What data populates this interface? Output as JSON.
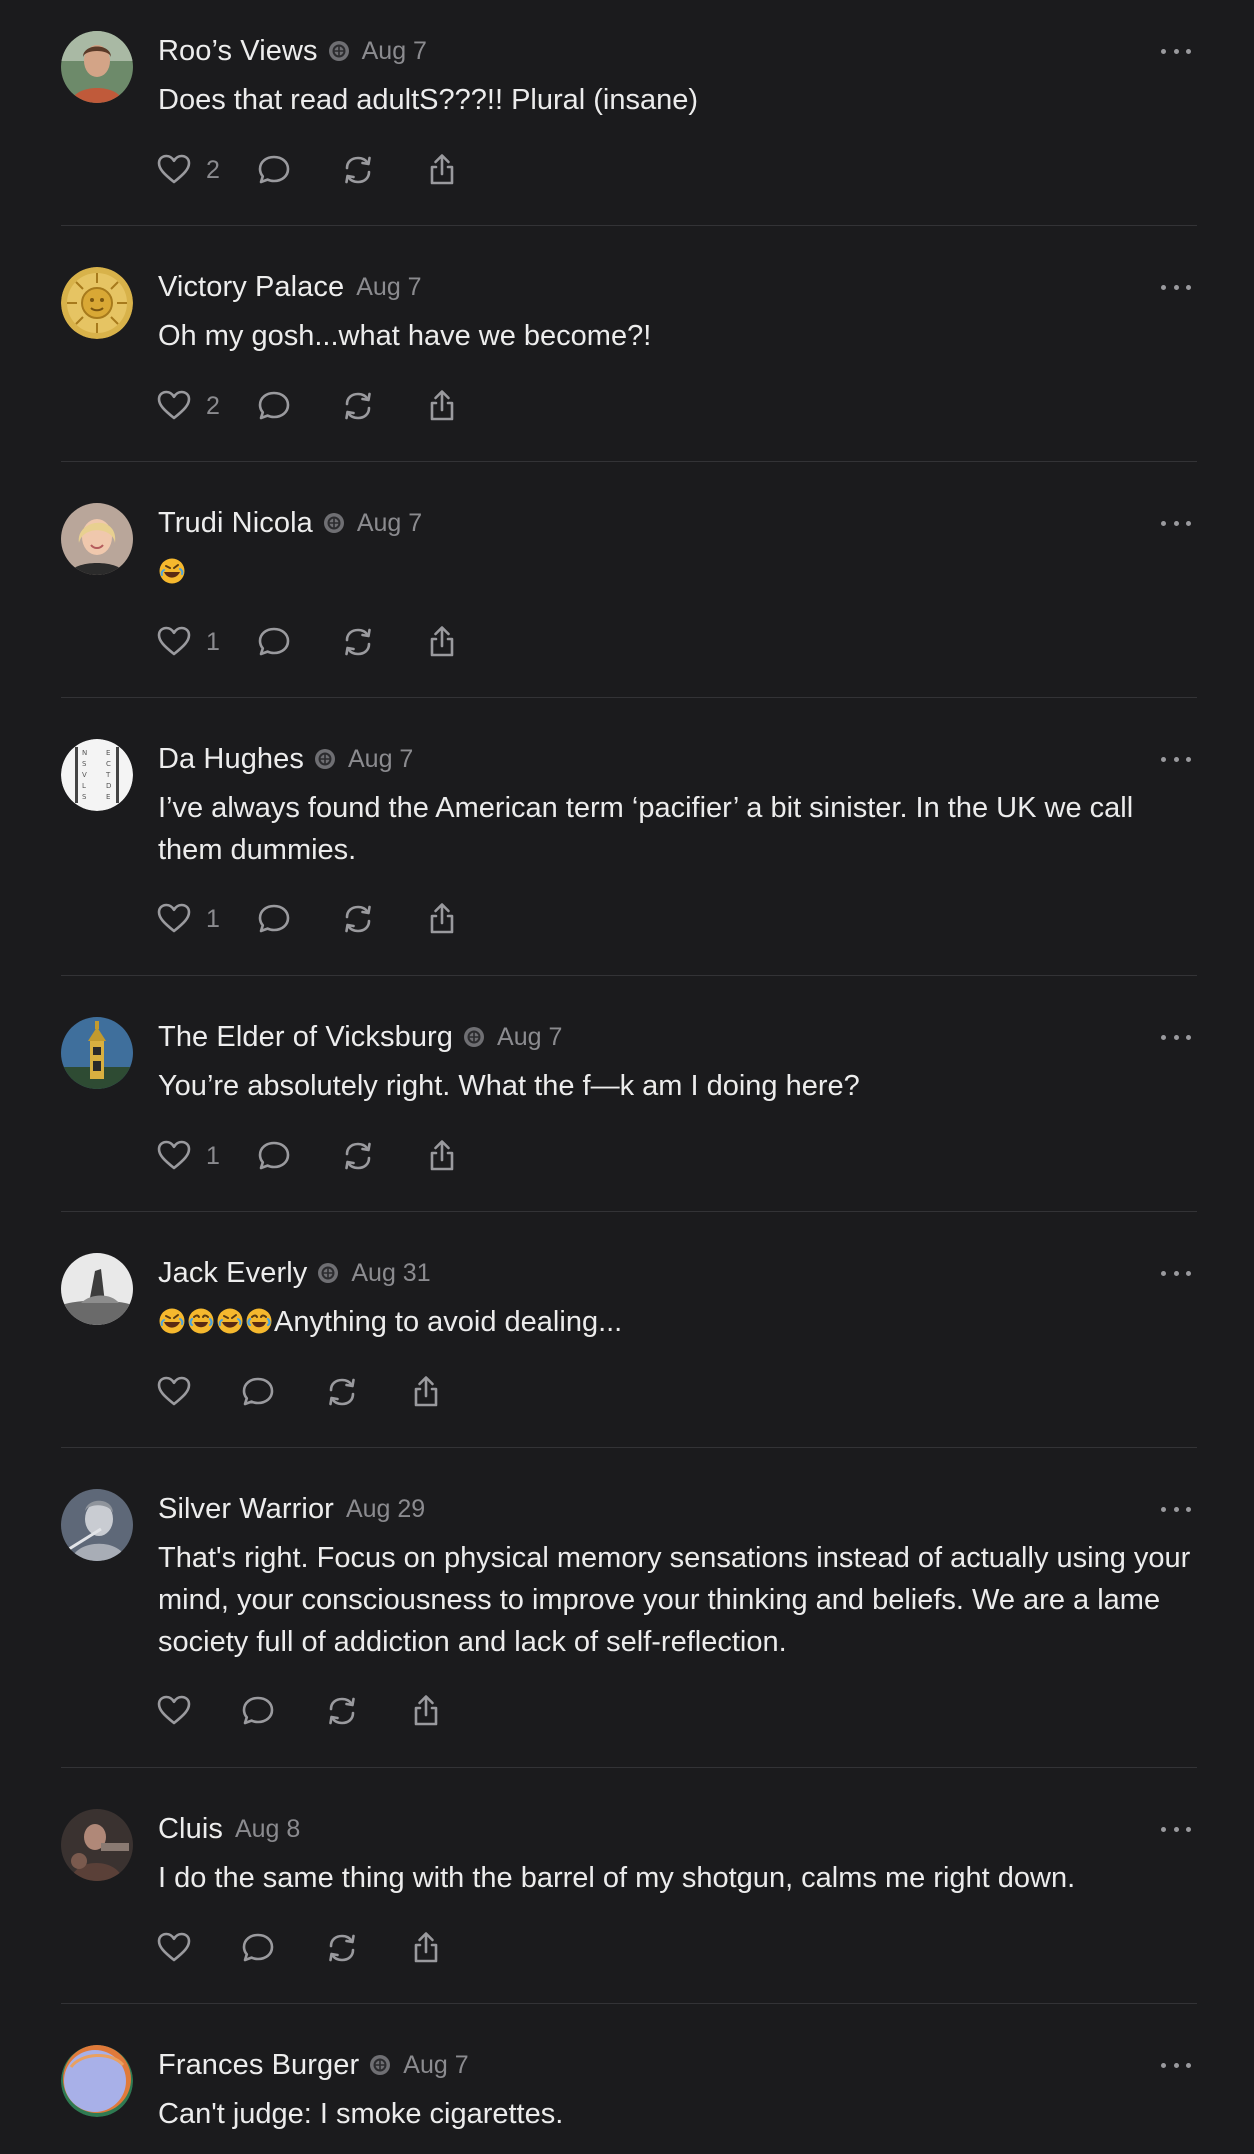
{
  "comments": [
    {
      "author": "Roo’s Views",
      "verified": true,
      "date": "Aug 7",
      "text": "Does that read adultS???!! Plural (insane)",
      "likes": "2",
      "avatar": "person-photo"
    },
    {
      "author": "Victory Palace",
      "verified": false,
      "date": "Aug 7",
      "text": "Oh my gosh...what have we become?!",
      "likes": "2",
      "avatar": "gold-sun-emblem"
    },
    {
      "author": "Trudi Nicola",
      "verified": true,
      "date": "Aug 7",
      "text": "",
      "emoji": [
        "rofl"
      ],
      "likes": "1",
      "avatar": "person-photo"
    },
    {
      "author": "Da Hughes",
      "verified": true,
      "date": "Aug 7",
      "text": "I’ve always found the American term ‘pacifier’ a bit sinister. In the UK we call them dummies.",
      "likes": "1",
      "avatar": "newspaper-columns"
    },
    {
      "author": "The Elder of Vicksburg",
      "verified": true,
      "date": "Aug 7",
      "text": "You’re absolutely right. What the f—k am I doing here?",
      "likes": "1",
      "avatar": "clock-tower"
    },
    {
      "author": "Jack Everly",
      "verified": true,
      "date": "Aug 31",
      "text": "Anything to avoid dealing...",
      "emoji": [
        "rofl",
        "joy",
        "rofl",
        "joy"
      ],
      "likes": "",
      "avatar": "bw-photo"
    },
    {
      "author": "Silver Warrior",
      "verified": false,
      "date": "Aug 29",
      "text": "That's right. Focus on physical memory sensations instead of actually using your mind, your consciousness to improve your thinking and beliefs. We are a lame society full of addiction and lack of self-reflection.",
      "likes": "",
      "avatar": "silver-figure"
    },
    {
      "author": "Cluis",
      "verified": false,
      "date": "Aug 8",
      "text": "I do the same thing with the barrel of my shotgun, calms me right down.",
      "likes": "",
      "avatar": "person-photo"
    },
    {
      "author": "Frances Burger",
      "verified": true,
      "date": "Aug 7",
      "text": "Can't judge: I smoke cigarettes.",
      "likes": "",
      "avatar": "abstract-circles"
    }
  ],
  "icons": {
    "like": "heart-icon",
    "reply": "speech-bubble-icon",
    "repost": "repost-icon",
    "share": "share-icon",
    "more": "more-options-icon",
    "verified": "verified-badge-icon"
  },
  "colors": {
    "background": "#1b1b1d",
    "text": "#ececec",
    "muted": "#8b8b8f",
    "divider": "#333336"
  }
}
